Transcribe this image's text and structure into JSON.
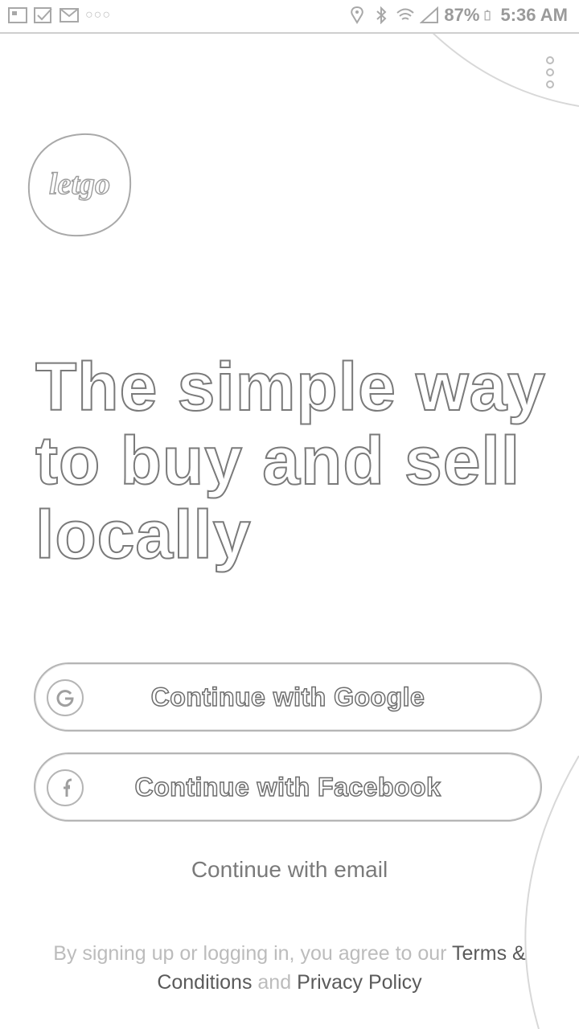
{
  "status_bar": {
    "battery": "87%",
    "time": "5:36 AM",
    "notification_icons": [
      "photo-icon",
      "checkbox-icon",
      "mail-icon",
      "more-dots-icon"
    ],
    "system_icons": [
      "location-icon",
      "bluetooth-icon",
      "wifi-icon",
      "signal-icon",
      "battery-icon"
    ]
  },
  "app": {
    "logo_text": "letgo"
  },
  "headline": {
    "line1": "The simple way",
    "line2": "to buy and sell",
    "line3": "locally"
  },
  "buttons": {
    "google": "Continue with Google",
    "facebook": "Continue with Facebook",
    "email": "Continue with email"
  },
  "legal": {
    "prefix": "By signing up or logging in, you agree to our",
    "terms": "Terms & Conditions",
    "and": "and",
    "privacy": "Privacy Policy"
  },
  "colors": {
    "outline_text": "#7a7a7a",
    "border": "#b5b5b5",
    "muted_text": "#bcbcbc"
  }
}
